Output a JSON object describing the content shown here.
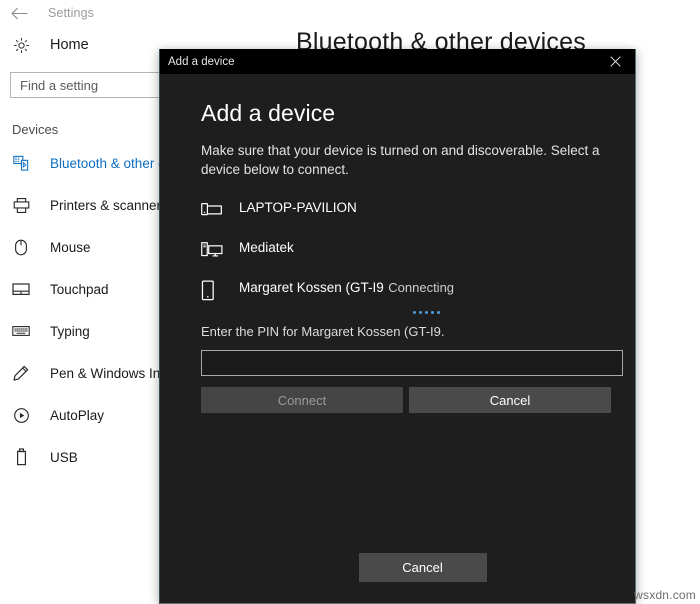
{
  "settings_window": {
    "titlebar": {
      "back_icon": "back-arrow-icon",
      "title": "Settings"
    },
    "home": {
      "icon": "gear-icon",
      "label": "Home"
    },
    "search": {
      "placeholder": "Find a setting",
      "value": ""
    },
    "nav_heading": "Devices",
    "nav_items": [
      {
        "label": "Bluetooth & other devices",
        "icon": "bluetooth-devices-icon",
        "selected": true
      },
      {
        "label": "Printers & scanners",
        "icon": "printer-icon",
        "selected": false
      },
      {
        "label": "Mouse",
        "icon": "mouse-icon",
        "selected": false
      },
      {
        "label": "Touchpad",
        "icon": "touchpad-icon",
        "selected": false
      },
      {
        "label": "Typing",
        "icon": "keyboard-icon",
        "selected": false
      },
      {
        "label": "Pen & Windows Ink",
        "icon": "pen-icon",
        "selected": false
      },
      {
        "label": "AutoPlay",
        "icon": "autoplay-icon",
        "selected": false
      },
      {
        "label": "USB",
        "icon": "usb-icon",
        "selected": false
      }
    ],
    "page_heading": "Bluetooth & other devices"
  },
  "dialog": {
    "titlebar_text": "Add a device",
    "close_icon": "close-icon",
    "heading": "Add a device",
    "subtext": "Make sure that your device is turned on and discoverable. Select a device below to connect.",
    "devices": [
      {
        "name": "LAPTOP-PAVILION",
        "status": "",
        "icon": "laptop-phone-icon"
      },
      {
        "name": "Mediatek",
        "status": "",
        "icon": "desktop-pc-icon"
      },
      {
        "name": "Margaret Kossen (GT-I9",
        "status": "Connecting",
        "icon": "phone-icon"
      }
    ],
    "progress_dots": 5,
    "pin_prompt": "Enter the PIN for Margaret Kossen (GT-I9.",
    "pin_input_value": "",
    "connect_label": "Connect",
    "connect_disabled": true,
    "cancel_label": "Cancel",
    "footer_cancel_label": "Cancel"
  },
  "watermark": "wsxdn.com",
  "colors": {
    "dialog_bg": "#1e1e1e",
    "titlebar_bg": "#000000",
    "accent_blue": "#0d6ebf",
    "progress_dot": "#4d9ae0",
    "button_bg": "#4a4a4a"
  }
}
